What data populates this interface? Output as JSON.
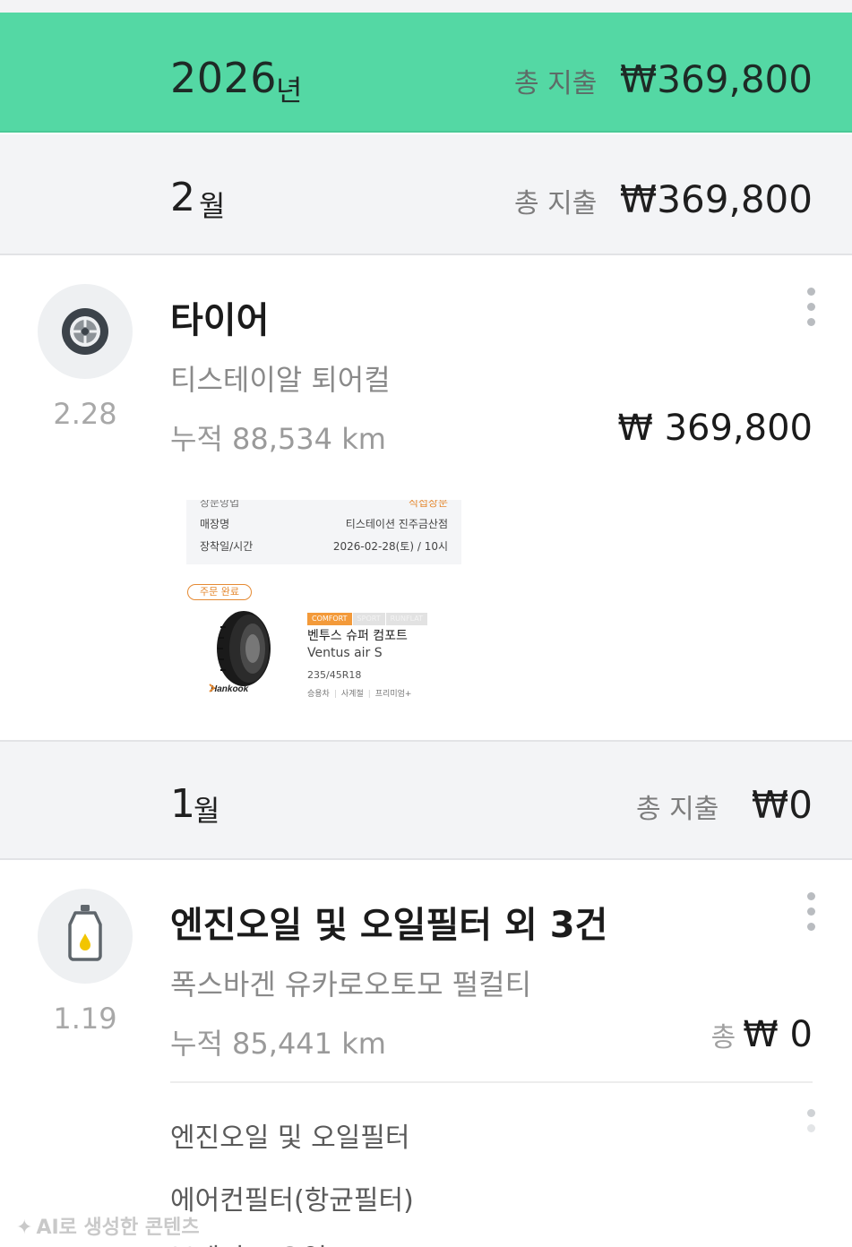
{
  "year": {
    "number": "2026",
    "unit": "년",
    "total_label": "총 지출",
    "total_value": "₩369,800"
  },
  "months": [
    {
      "number": "2",
      "unit": "월",
      "total_label": "총 지출",
      "total_value": "₩369,800",
      "record": {
        "icon": "tire-icon",
        "date": "2.28",
        "title": "타이어",
        "shop": "티스테이알 퇴어컬",
        "odometer": "누적 88,534 km",
        "price": "₩ 369,800",
        "attachment": {
          "cut_row_label": "장문방법",
          "cut_row_value": "직접장문",
          "store_label": "매장명",
          "store_value": "티스테이션 진주금산점",
          "time_label": "장착일/시간",
          "time_value": "2026-02-28(토) / 10시",
          "order_status": "주문 완료",
          "tags": [
            "COMFORT",
            "SPORT",
            "RUNFLAT"
          ],
          "product_name_kr": "벤투스 슈퍼 컴포트",
          "product_name_en": "Ventus air S",
          "size": "235/45R18",
          "meta": [
            "승용차",
            "사계절",
            "프리미엄+"
          ],
          "brand": "Hankook"
        }
      }
    },
    {
      "number": "1",
      "unit": "월",
      "total_label": "총 지출",
      "total_value": "₩0",
      "record": {
        "icon": "engine-oil-icon",
        "date": "1.19",
        "title": "엔진오일 및 오일필터 외 3건",
        "shop": "폭스바겐 유카로오토모 펄컬티",
        "odometer": "누적 85,441 km",
        "price_prefix": "총",
        "price": "₩ 0",
        "items": [
          "엔진오일 및 오일필터",
          "에어컨필터(항균필터)",
          "브레이크 오일"
        ]
      }
    }
  ],
  "watermark": "AI로 생성한 콘텐츠",
  "colors": {
    "year_bar": "#54d8a4",
    "month_bar": "#f3f4f6",
    "accent_orange": "#e58a33"
  }
}
